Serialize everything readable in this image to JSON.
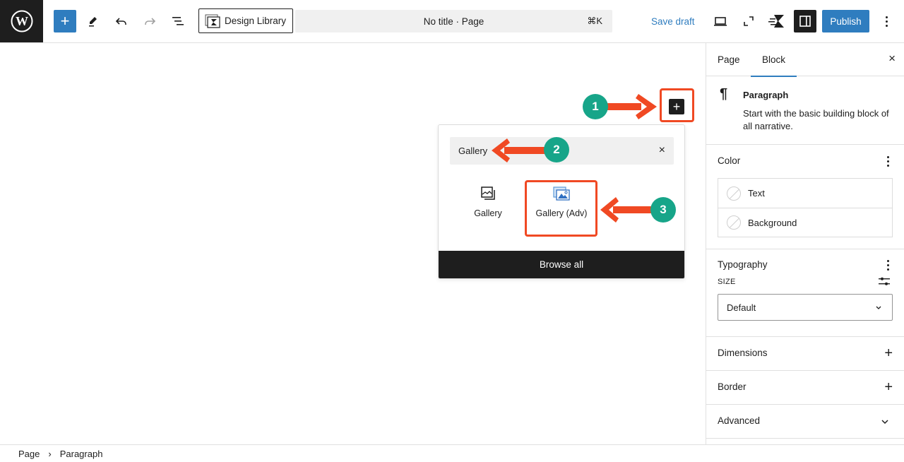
{
  "topbar": {
    "logo": "wordpress-logo",
    "inserter_icon": "+",
    "design_library_label": "Design Library",
    "command_bar_label": "No title · Page",
    "command_shortcut": "⌘K",
    "save_draft_label": "Save draft",
    "publish_label": "Publish"
  },
  "canvas": {
    "add_block_icon": "+",
    "annotations": [
      {
        "number": "1",
        "color": "#17a589"
      },
      {
        "number": "2",
        "color": "#17a589"
      },
      {
        "number": "3",
        "color": "#17a589"
      }
    ],
    "highlight_color": "#f04923",
    "inserter": {
      "search_value": "Gallery",
      "clear_icon": "×",
      "results": [
        {
          "label": "Gallery",
          "icon": "gallery-icon"
        },
        {
          "label": "Gallery (Adv)",
          "icon": "gallery-adv-icon"
        }
      ],
      "browse_all_label": "Browse all"
    }
  },
  "sidebar": {
    "tabs": [
      {
        "label": "Page",
        "active": false
      },
      {
        "label": "Block",
        "active": true
      }
    ],
    "close_icon": "×",
    "block_card": {
      "icon": "¶",
      "title": "Paragraph",
      "description": "Start with the basic building block of all narrative."
    },
    "color_panel": {
      "title": "Color",
      "items": [
        {
          "label": "Text"
        },
        {
          "label": "Background"
        }
      ]
    },
    "typography_panel": {
      "title": "Typography",
      "size_label": "SIZE",
      "size_value": "Default"
    },
    "collapsed_panels": [
      {
        "title": "Dimensions",
        "toggle": "+"
      },
      {
        "title": "Border",
        "toggle": "+"
      },
      {
        "title": "Advanced",
        "toggle": "⌄"
      }
    ]
  },
  "footer": {
    "breadcrumb": [
      "Page",
      "Paragraph"
    ],
    "separator": "›"
  },
  "colors": {
    "accent": "#2f7dbf",
    "dark": "#1e1e1e"
  }
}
